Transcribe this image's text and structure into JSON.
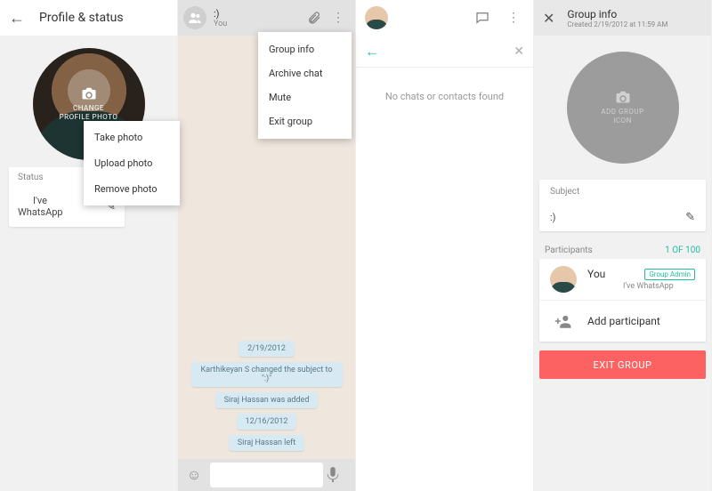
{
  "pane1": {
    "title": "Profile & status",
    "avatar_overlay_line1": "CHANGE",
    "avatar_overlay_line2": "PROFILE PHOTO",
    "menu": [
      "Take photo",
      "Upload photo",
      "Remove photo"
    ],
    "status_label": "Status",
    "status_value": "I've WhatsApp"
  },
  "pane2": {
    "title": ":)",
    "subtitle": "You",
    "menu": [
      "Group info",
      "Archive chat",
      "Mute",
      "Exit group"
    ],
    "bubbles": [
      "2/19/2012",
      "Karthikeyan S changed the subject to \":)\"",
      "Siraj Hassan was added",
      "12/16/2012",
      "Siraj Hassan left"
    ]
  },
  "pane3": {
    "empty_text": "No chats or contacts found"
  },
  "pane4": {
    "title": "Group info",
    "subtitle": "Created 2/19/2012 at 11:59 AM",
    "icon_line1": "ADD GROUP",
    "icon_line2": "ICON",
    "subject_label": "Subject",
    "subject_value": ":)",
    "participants_label": "Participants",
    "participants_count": "1 OF 100",
    "you_name": "You",
    "you_badge": "Group Admin",
    "you_status": "I've WhatsApp",
    "add_participant": "Add participant",
    "exit_button": "EXIT GROUP"
  }
}
